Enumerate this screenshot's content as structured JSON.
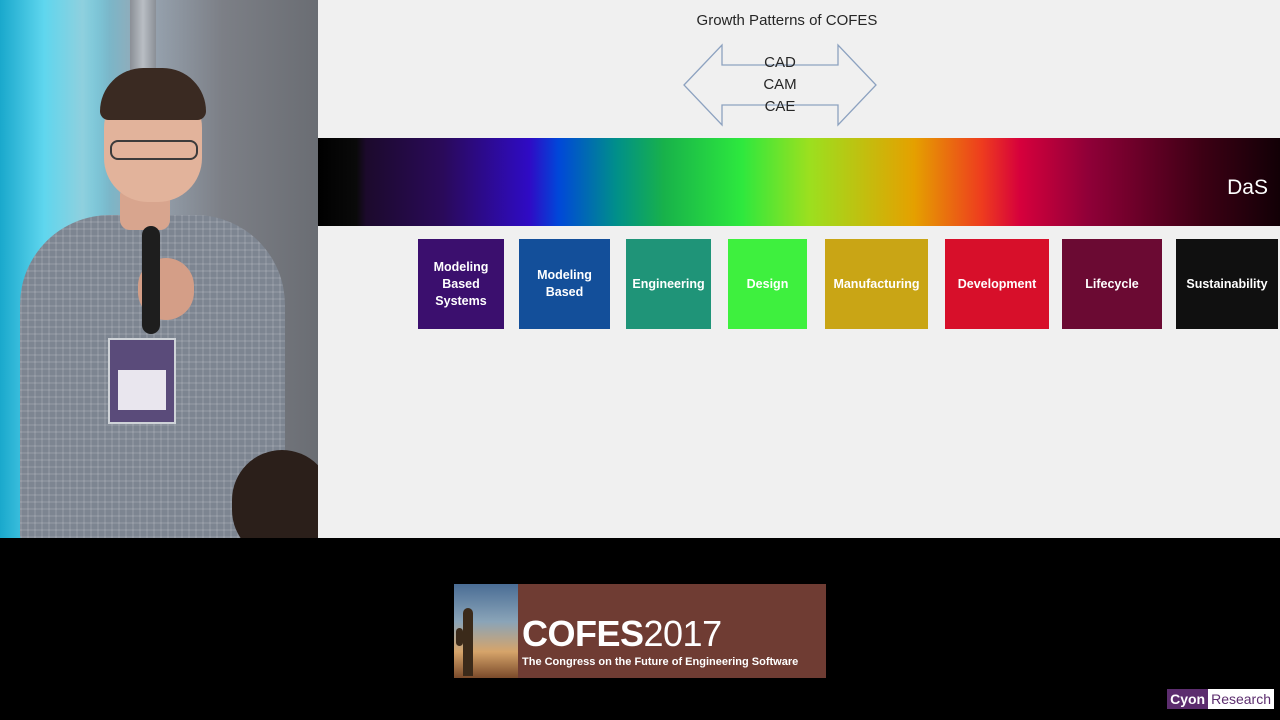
{
  "slide": {
    "title": "Growth Patterns of COFES",
    "arrow_labels": [
      "CAD",
      "CAM",
      "CAE"
    ],
    "spectrum_label": "DaS",
    "boxes": [
      {
        "label": "Modeling Based Systems",
        "color": "#3b0f6e"
      },
      {
        "label": "Modeling Based",
        "color": "#134f9a"
      },
      {
        "label": "Engineering",
        "color": "#1f9478"
      },
      {
        "label": "Design",
        "color": "#3ef03e"
      },
      {
        "label": "Manufacturing",
        "color": "#c9a515"
      },
      {
        "label": "Development",
        "color": "#d70f2a"
      },
      {
        "label": "Lifecycle",
        "color": "#6b0a33"
      },
      {
        "label": "Sustainability",
        "color": "#101010"
      }
    ]
  },
  "banner": {
    "title_main": "COFES",
    "title_year": "2017",
    "subtitle": "The Congress on the Future of Engineering Software"
  },
  "watermark": {
    "part1": "Cyon",
    "part2": "Research"
  }
}
